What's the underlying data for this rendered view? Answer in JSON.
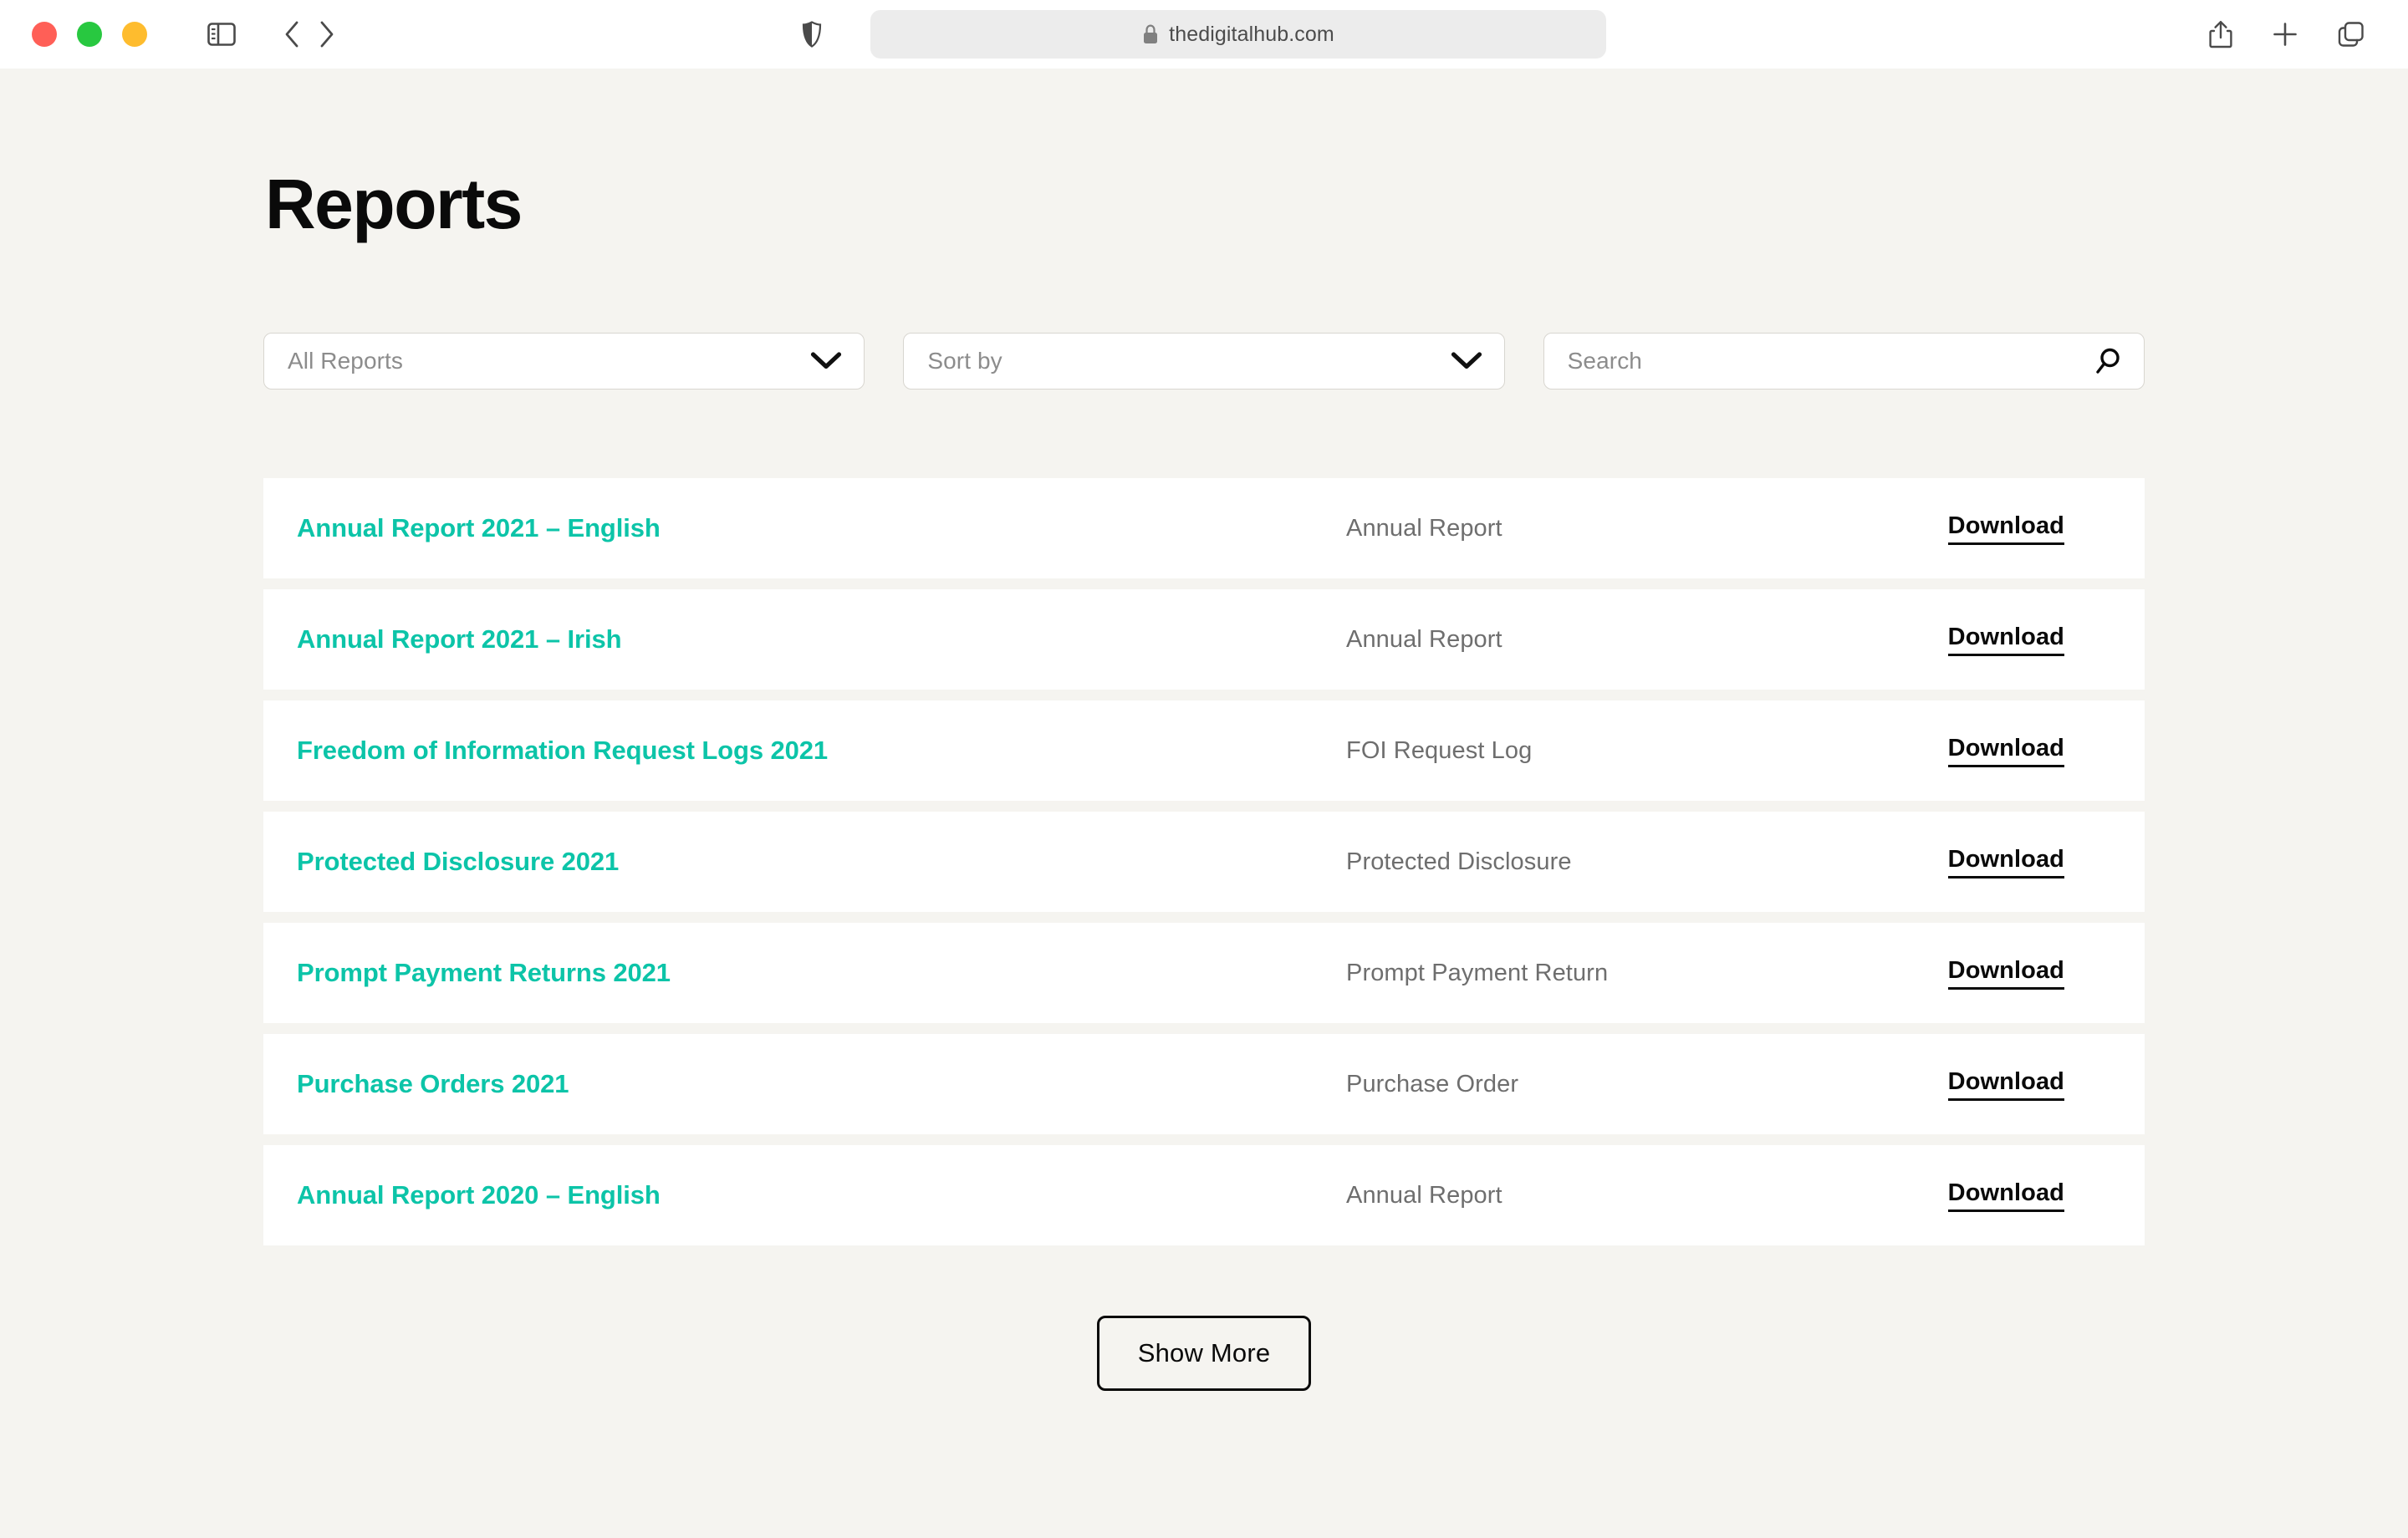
{
  "browser": {
    "traffic_lights": [
      {
        "name": "close",
        "color": "#ff5f57"
      },
      {
        "name": "minimize",
        "color": "#28c840"
      },
      {
        "name": "maximize",
        "color": "#febc2e"
      }
    ],
    "sidebar_toggle_icon": "sidebar-icon",
    "back_icon": "chevron-left-icon",
    "forward_icon": "chevron-right-icon",
    "shield_icon": "shield-icon",
    "lock_icon": "lock-icon",
    "url": "thedigitalhub.com",
    "share_icon": "share-icon",
    "new_tab_icon": "plus-icon",
    "tab_overview_icon": "tabs-icon"
  },
  "page": {
    "title": "Reports",
    "background_color": "#f5f4f0",
    "accent_color": "#0cc4a8"
  },
  "filters": {
    "category": {
      "value": "All Reports",
      "icon": "chevron-down-icon"
    },
    "sort": {
      "value": "Sort by",
      "icon": "chevron-down-icon"
    },
    "search": {
      "placeholder": "Search",
      "value": "",
      "icon": "search-icon"
    }
  },
  "reports": {
    "download_label": "Download",
    "items": [
      {
        "title": "Annual Report 2021 – English",
        "category": "Annual Report",
        "download": "Download"
      },
      {
        "title": "Annual Report 2021 – Irish",
        "category": "Annual Report",
        "download": "Download"
      },
      {
        "title": "Freedom of Information Request Logs 2021",
        "category": "FOI Request Log",
        "download": "Download"
      },
      {
        "title": "Protected Disclosure 2021",
        "category": "Protected Disclosure",
        "download": "Download"
      },
      {
        "title": "Prompt Payment Returns 2021",
        "category": "Prompt Payment Return",
        "download": "Download"
      },
      {
        "title": "Purchase Orders 2021",
        "category": "Purchase Order",
        "download": "Download"
      },
      {
        "title": "Annual Report 2020 – English",
        "category": "Annual Report",
        "download": "Download"
      }
    ]
  },
  "show_more": {
    "label": "Show More"
  }
}
